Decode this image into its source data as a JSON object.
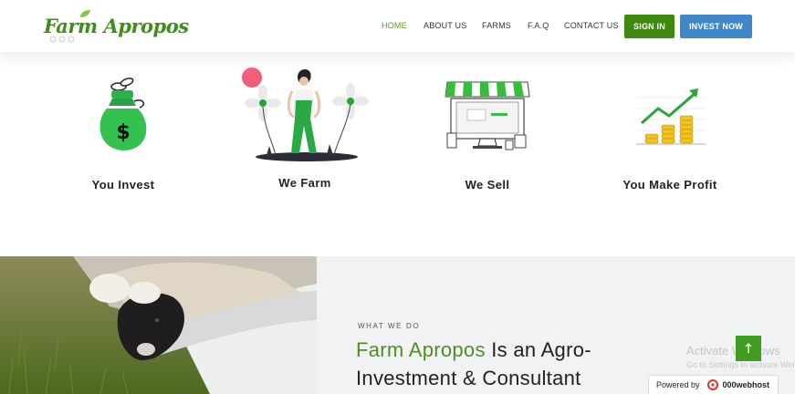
{
  "header": {
    "logo_text": "Farm Apropos",
    "nav": [
      {
        "label": "HOME",
        "active": true
      },
      {
        "label": "ABOUT US",
        "active": false
      },
      {
        "label": "FARMS",
        "active": false
      },
      {
        "label": "F.A.Q",
        "active": false
      },
      {
        "label": "CONTACT US",
        "active": false
      }
    ],
    "sign_in_label": "SIGN IN",
    "invest_label": "INVEST NOW"
  },
  "steps": [
    {
      "label": "You Invest",
      "icon": "money-bag-icon"
    },
    {
      "label": "We Farm",
      "icon": "farmer-illustration"
    },
    {
      "label": "We Sell",
      "icon": "online-store-icon"
    },
    {
      "label": "You Make Profit",
      "icon": "profit-chart-icon"
    }
  ],
  "what_we_do": {
    "eyebrow": "WHAT WE DO",
    "title_brand": "Farm Apropos",
    "title_rest_line1": " Is an Agro-",
    "title_line2": "Investment & Consultant"
  },
  "overlays": {
    "activate_title": "Activate Windows",
    "activate_sub": "Go to Settings to activate Windows.",
    "scroll_top_icon": "arrow-up-icon",
    "powered_by": "Powered by",
    "host_brand": "000webhost"
  },
  "colors": {
    "brand_green": "#4e8f25",
    "sign_in_bg": "#3e8a10",
    "invest_bg": "#3f87c9",
    "lower_bg": "#f1f2f4"
  }
}
